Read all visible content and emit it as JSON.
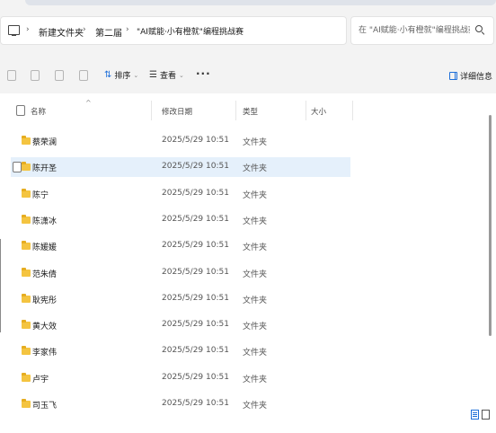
{
  "breadcrumb": {
    "items": [
      "新建文件夹",
      "第二届",
      "\"AI赋能·小有橙就\"编程挑战赛"
    ],
    "separator": "›"
  },
  "search": {
    "placeholder": "在 \"AI赋能·小有橙就\"编程挑战赛 中搜索"
  },
  "toolbar": {
    "sort_label": "排序",
    "view_label": "查看",
    "more_label": "···",
    "details_label": "详细信息"
  },
  "columns": {
    "name": "名称",
    "modified": "修改日期",
    "type": "类型",
    "size": "大小"
  },
  "rows": [
    {
      "name": "蔡荣澜",
      "date": "2025/5/29 10:51",
      "type": "文件夹"
    },
    {
      "name": "陈开圣",
      "date": "2025/5/29 10:51",
      "type": "文件夹",
      "selected": true
    },
    {
      "name": "陈宁",
      "date": "2025/5/29 10:51",
      "type": "文件夹"
    },
    {
      "name": "陈潇冰",
      "date": "2025/5/29 10:51",
      "type": "文件夹"
    },
    {
      "name": "陈媛媛",
      "date": "2025/5/29 10:51",
      "type": "文件夹"
    },
    {
      "name": "范朱倩",
      "date": "2025/5/29 10:51",
      "type": "文件夹"
    },
    {
      "name": "耿宪彤",
      "date": "2025/5/29 10:51",
      "type": "文件夹"
    },
    {
      "name": "黄大效",
      "date": "2025/5/29 10:51",
      "type": "文件夹"
    },
    {
      "name": "李家伟",
      "date": "2025/5/29 10:51",
      "type": "文件夹"
    },
    {
      "name": "卢宇",
      "date": "2025/5/29 10:51",
      "type": "文件夹"
    },
    {
      "name": "司玉飞",
      "date": "2025/5/29 10:51",
      "type": "文件夹"
    }
  ],
  "colors": {
    "accent": "#1e6fd9",
    "folder": "#f4c440",
    "selected_row": "#e5f0fb"
  }
}
